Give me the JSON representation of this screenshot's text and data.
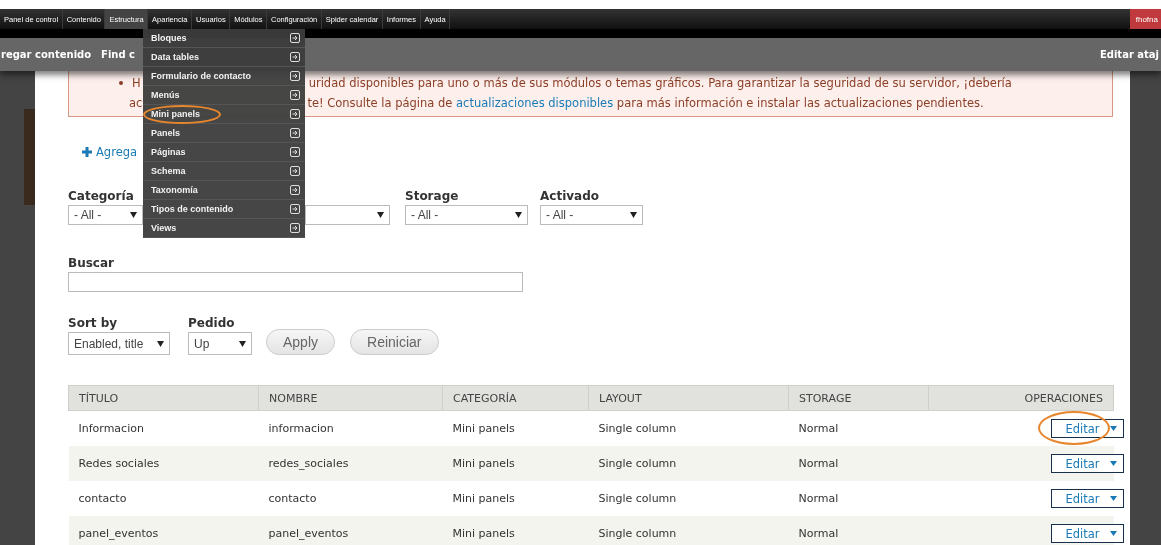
{
  "toolbar": {
    "items": [
      {
        "label": "Panel de control",
        "selected": false
      },
      {
        "label": "Contenido",
        "selected": false
      },
      {
        "label": "Estructura",
        "selected": true
      },
      {
        "label": "Apariencia",
        "selected": false
      },
      {
        "label": "Usuarios",
        "selected": false
      },
      {
        "label": "Módulos",
        "selected": false
      },
      {
        "label": "Configuración",
        "selected": false
      },
      {
        "label": "Spider calendar",
        "selected": false
      },
      {
        "label": "Informes",
        "selected": false
      },
      {
        "label": "Ayuda",
        "selected": false
      }
    ],
    "user": "fhofna"
  },
  "shortcuts": {
    "items": [
      "regar contenido",
      "Find c"
    ],
    "edit": "Editar ataj"
  },
  "dropdown_menu": [
    {
      "label": "Bloques",
      "circled": false
    },
    {
      "label": "Data tables",
      "circled": false
    },
    {
      "label": "Formulario de contacto",
      "circled": false
    },
    {
      "label": "Menús",
      "circled": false
    },
    {
      "label": "Mini panels",
      "circled": true
    },
    {
      "label": "Panels",
      "circled": false
    },
    {
      "label": "Páginas",
      "circled": false
    },
    {
      "label": "Schema",
      "circled": false
    },
    {
      "label": "Taxonomía",
      "circled": false
    },
    {
      "label": "Tipos de contenido",
      "circled": false
    },
    {
      "label": "Views",
      "circled": false
    }
  ],
  "message": {
    "line_1_start": "H",
    "line_1_end": "uridad disponibles para uno o más de sus módulos o temas gráficos. Para garantizar la seguridad de su servidor, ¡debería",
    "line_2_start": "ac",
    "line_2_end_before": "te! Consulte la página de ",
    "link": "actualizaciones disponibles",
    "line_2_end_after": " para más información e instalar las actualizaciones pendientes."
  },
  "add_link": "Agrega",
  "filters": [
    {
      "label": "Categoría",
      "value": "- All -"
    },
    {
      "label": "Storage",
      "value": "- All -"
    },
    {
      "label": "Activado",
      "value": "- All -"
    }
  ],
  "search": {
    "label": "Buscar"
  },
  "sort": [
    {
      "label": "Sort by",
      "value": "Enabled, title"
    },
    {
      "label": "Pedido",
      "value": "Up"
    }
  ],
  "buttons": [
    "Apply",
    "Reiniciar"
  ],
  "table": {
    "columns": [
      "TÍTULO",
      "NOMBRE",
      "CATEGORÍA",
      "LAYOUT",
      "STORAGE",
      "OPERACIONES"
    ],
    "rows": [
      {
        "cells": [
          "Informacion",
          "informacion",
          "Mini panels",
          "Single column",
          "Normal"
        ],
        "action": "Editar",
        "circled": true
      },
      {
        "cells": [
          "Redes sociales",
          "redes_sociales",
          "Mini panels",
          "Single column",
          "Normal"
        ],
        "action": "Editar",
        "circled": false
      },
      {
        "cells": [
          "contacto",
          "contacto",
          "Mini panels",
          "Single column",
          "Normal"
        ],
        "action": "Editar",
        "circled": false
      },
      {
        "cells": [
          "panel_eventos",
          "panel_eventos",
          "Mini panels",
          "Single column",
          "Normal"
        ],
        "action": "Editar",
        "circled": false
      }
    ]
  }
}
